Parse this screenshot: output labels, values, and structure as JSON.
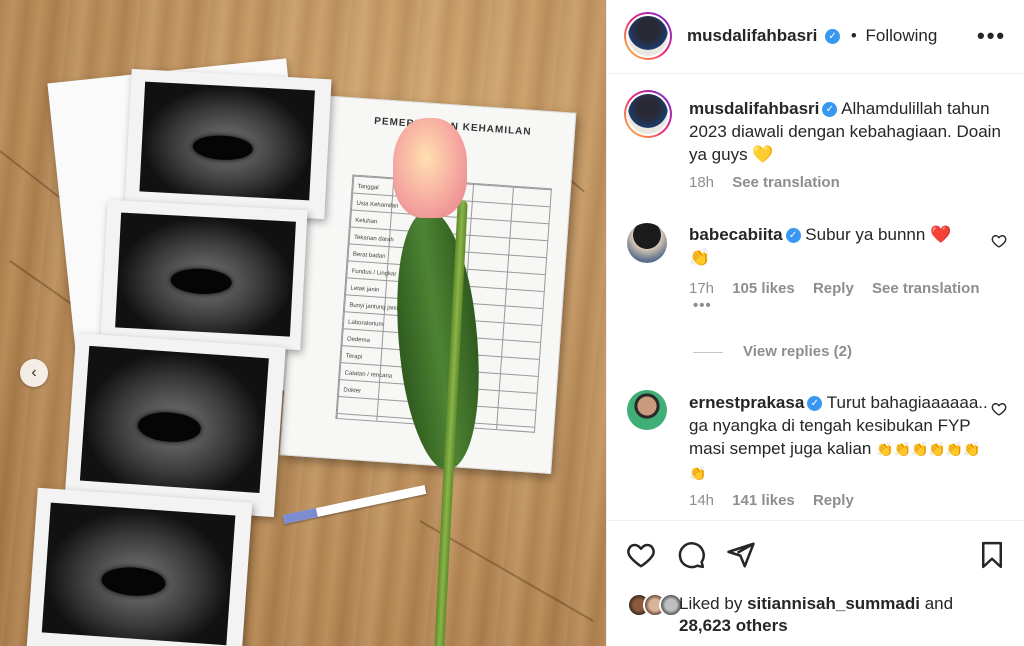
{
  "header": {
    "username": "musdalifahbasri",
    "separator": "•",
    "follow_status": "Following",
    "more": "•••"
  },
  "caption": {
    "username": "musdalifahbasri",
    "text": "Alhamdulillah tahun 2023 diawali dengan kebahagiaan. Doain ya guys",
    "emoji": "💛",
    "time": "18h",
    "see_translation": "See translation"
  },
  "comments": [
    {
      "username": "babecabiita",
      "text": "Subur ya bunnn",
      "emoji_1": "❤️",
      "emoji_2": "👏",
      "time": "17h",
      "likes": "105 likes",
      "reply": "Reply",
      "see_translation": "See translation",
      "more": "•••",
      "view_replies": "View replies (2)"
    },
    {
      "username": "ernestprakasa",
      "text": "Turut bahagiaaaaaa.. ga nyangka di tengah kesibukan FYP masi sempet juga kalian",
      "emoji": "👏👏👏👏👏👏👏",
      "time": "14h",
      "likes": "141 likes",
      "reply": "Reply"
    }
  ],
  "likes": {
    "prefix": "Liked by",
    "user": "sitiannisah_summadi",
    "and": "and",
    "others": "28,623 others"
  },
  "photo": {
    "book_title": "PEMERIKSAAN KEHAMILAN",
    "book_rows": "Tanggal\nUsia Kehamilan\nKeluhan\nTekanan darah\nBerat badan\nFundus / Lingkar\nLetak janin\nBunyi jantung janin\nLaboratorium\nOedema\nTerapi\nCatatan / rencana\nDokter"
  },
  "colors": {
    "verified": "#3897f0",
    "muted": "#8e8e8e",
    "text": "#262626"
  }
}
